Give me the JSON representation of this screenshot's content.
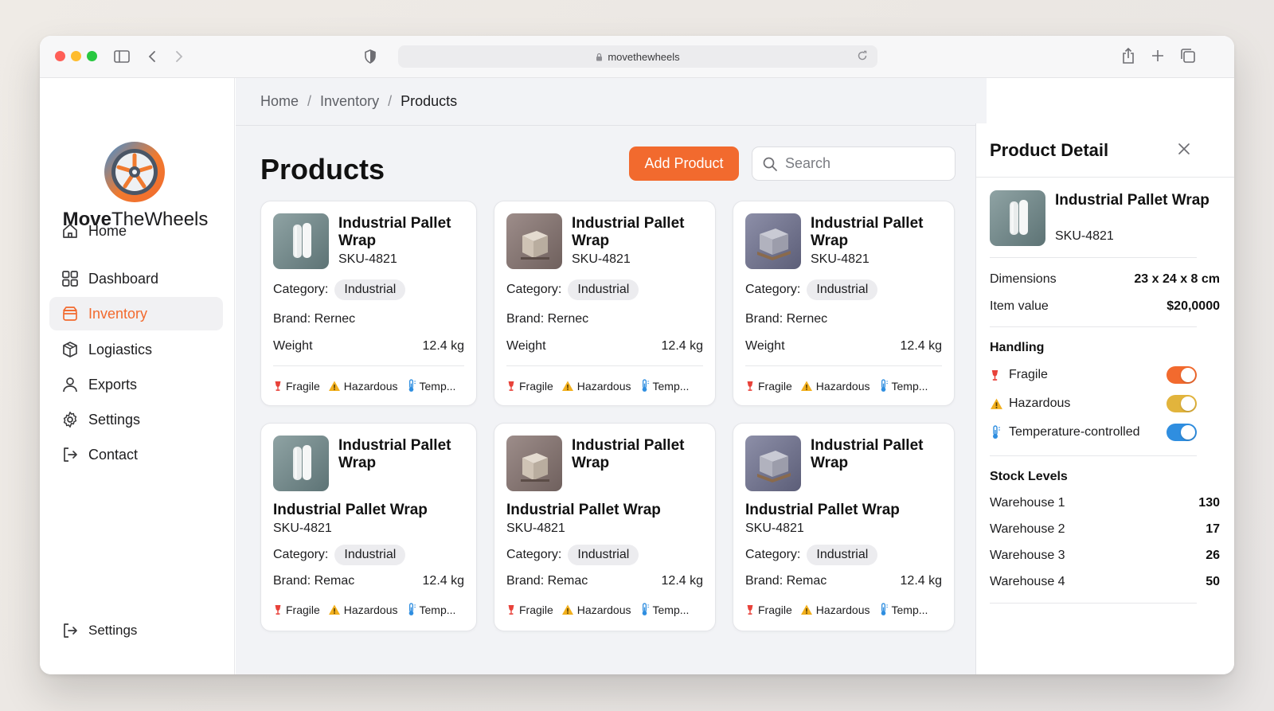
{
  "browser": {
    "url": "movethewheels"
  },
  "brand": {
    "name_bold": "Move",
    "name_rest": "TheWheels"
  },
  "sidebar": {
    "items": [
      {
        "label": "Home",
        "icon": "home-icon"
      },
      {
        "label": "Dashboard",
        "icon": "dashboard-icon"
      },
      {
        "label": "Inventory",
        "icon": "inventory-icon",
        "active": true
      },
      {
        "label": "Logiastics",
        "icon": "box-icon"
      },
      {
        "label": "Exports",
        "icon": "user-icon"
      },
      {
        "label": "Settings",
        "icon": "gear-icon"
      },
      {
        "label": "Contact",
        "icon": "logout-icon"
      }
    ],
    "footer": {
      "label": "Settings",
      "icon": "logout-icon"
    }
  },
  "breadcrumb": [
    "Home",
    "Inventory",
    "Products"
  ],
  "page": {
    "title": "Products",
    "add_label": "Add Product",
    "search_placeholder": "Search"
  },
  "tags": {
    "fragile": "Fragile",
    "hazardous": "Hazardous",
    "temp": "Temp..."
  },
  "cards_top": [
    {
      "title": "Industrial Pallet Wrap",
      "sku": "SKU-4821",
      "category_label": "Category:",
      "category": "Industrial",
      "brand": "Brand: Rernec",
      "weight_label": "Weight",
      "weight": "12.4 kg",
      "thumb": "rolls"
    },
    {
      "title": "Industrial Pallet Wrap",
      "sku": "SKU-4821",
      "category_label": "Category:",
      "category": "Industrial",
      "brand": "Brand: Rernec",
      "weight_label": "Weight",
      "weight": "12.4 kg",
      "thumb": "box"
    },
    {
      "title": "Industrial Pallet Wrap",
      "sku": "SKU-4821",
      "category_label": "Category:",
      "category": "Industrial",
      "brand": "Brand: Rernec",
      "weight_label": "Weight",
      "weight": "12.4 kg",
      "thumb": "pallet"
    }
  ],
  "cards_bottom": [
    {
      "title": "Industrial Pallet Wrap",
      "name": "Industrial Pallet Wrap",
      "sku": "SKU-4821",
      "category_label": "Category:",
      "category": "Industrial",
      "brand": "Brand: Remac",
      "weight": "12.4 kg",
      "thumb": "rolls"
    },
    {
      "title": "Industrial Pallet Wrap",
      "name": "Industrial Pallet Wrap",
      "sku": "SKU-4821",
      "category_label": "Category:",
      "category": "Industrial",
      "brand": "Brand: Remac",
      "weight": "12.4 kg",
      "thumb": "box"
    },
    {
      "title": "Industrial Pallet Wrap",
      "name": "Industrial Pallet Wrap",
      "sku": "SKU-4821",
      "category_label": "Category:",
      "category": "Industrial",
      "brand": "Brand: Remac",
      "weight": "12.4 kg",
      "thumb": "pallet"
    }
  ],
  "detail": {
    "title": "Product Detail",
    "name": "Industrial Pallet Wrap",
    "sku": "SKU-4821",
    "dimensions_label": "Dimensions",
    "dimensions": "23 x 24 x 8 cm",
    "value_label": "Item value",
    "value": "$20,0000",
    "handling_title": "Handling",
    "handling": [
      {
        "label": "Fragile",
        "on": true,
        "color": "#f26a2e"
      },
      {
        "label": "Hazardous",
        "on": true,
        "color": "#e2b43c"
      },
      {
        "label": "Temperature-controlled",
        "on": true,
        "color": "#2f8ee0"
      }
    ],
    "stock_title": "Stock Levels",
    "stock": [
      {
        "label": "Warehouse 1",
        "value": "130"
      },
      {
        "label": "Warehouse 2",
        "value": "17"
      },
      {
        "label": "Warehouse 3",
        "value": "26"
      },
      {
        "label": "Warehouse 4",
        "value": "50"
      }
    ]
  },
  "colors": {
    "accent": "#f26a2e",
    "fragile": "#e8423a",
    "hazard": "#f2b01e",
    "temp": "#2f8ee0"
  }
}
